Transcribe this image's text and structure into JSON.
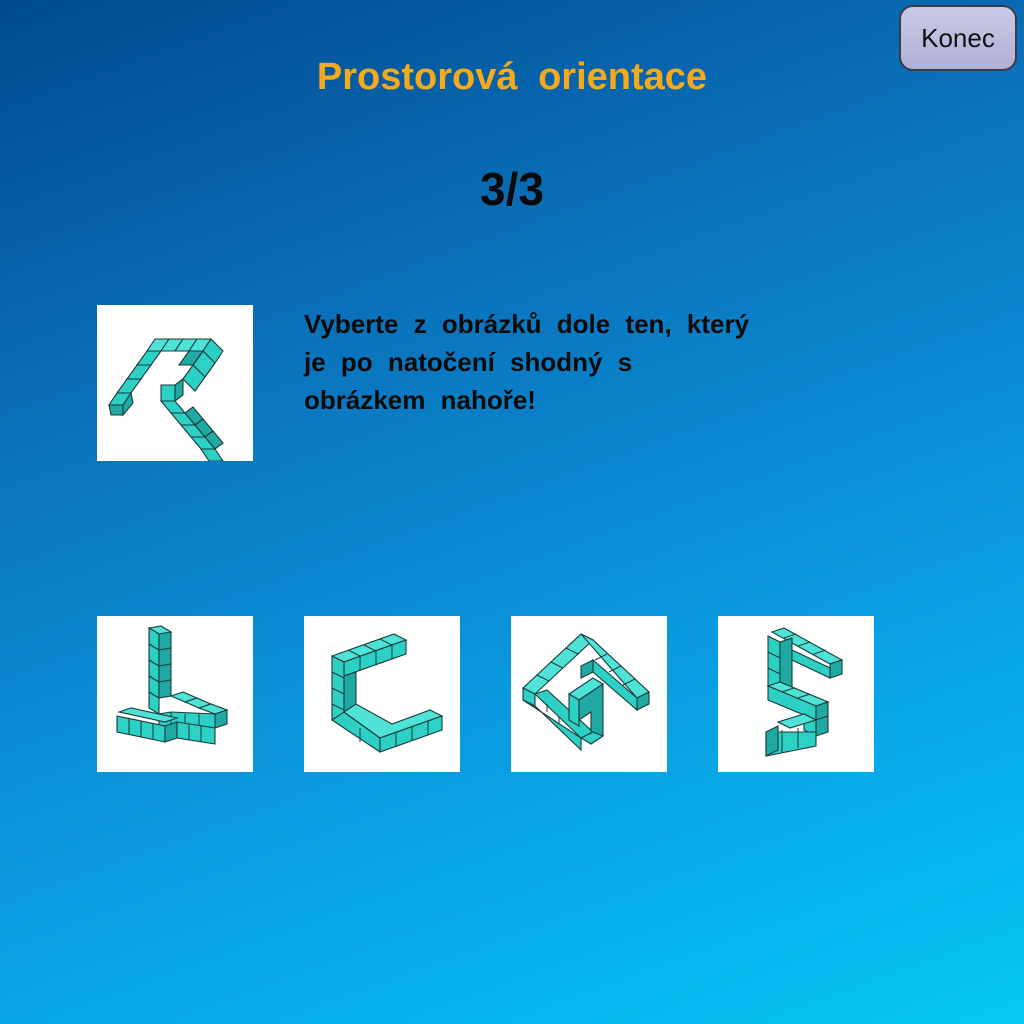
{
  "header": {
    "title": "Prostorová orientace",
    "end_button_label": "Konec"
  },
  "progress": {
    "counter": "3/3"
  },
  "instruction": {
    "lines": [
      "Vyberte z obrázků dole ten, který",
      "je po natočení shodný s",
      "obrázkem nahoře!"
    ]
  },
  "reference_figure": {
    "icon": "cube-figure-reference-icon"
  },
  "options": [
    {
      "icon": "cube-figure-option-1-icon"
    },
    {
      "icon": "cube-figure-option-2-icon"
    },
    {
      "icon": "cube-figure-option-3-icon"
    },
    {
      "icon": "cube-figure-option-4-icon"
    }
  ],
  "colors": {
    "title": "#f7a91c",
    "cube_face": "#2dd0c5",
    "cube_edge": "#1a3a3a",
    "button_bg": "#c0c0e0"
  }
}
